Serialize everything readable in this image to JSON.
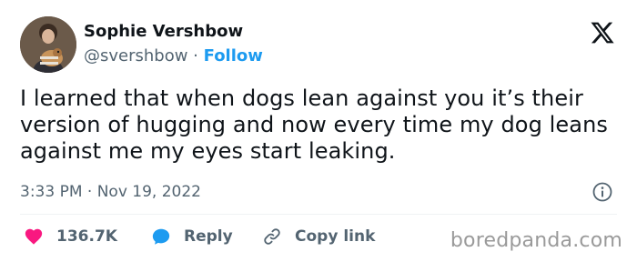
{
  "author": {
    "display_name": "Sophie Vershbow",
    "handle": "@svershbow",
    "separator": " · ",
    "follow_label": "Follow"
  },
  "tweet": {
    "text": "I learned that when dogs lean against you it’s their version of hugging and now every time my dog leans against me my eyes start leaking.",
    "timestamp": "3:33 PM · Nov 19, 2022"
  },
  "actions": {
    "like_count": "136.7K",
    "reply_label": "Reply",
    "copy_link_label": "Copy link"
  },
  "watermark": "boredpanda.com",
  "icons": {
    "logo": "x-logo-icon",
    "info": "info-icon",
    "like": "heart-icon",
    "reply": "speech-bubble-icon",
    "copy": "link-icon"
  },
  "colors": {
    "text": "#0f1419",
    "secondary": "#536471",
    "accent": "#1d9bf0",
    "like": "#f91880",
    "watermark": "#9a9a9a"
  }
}
